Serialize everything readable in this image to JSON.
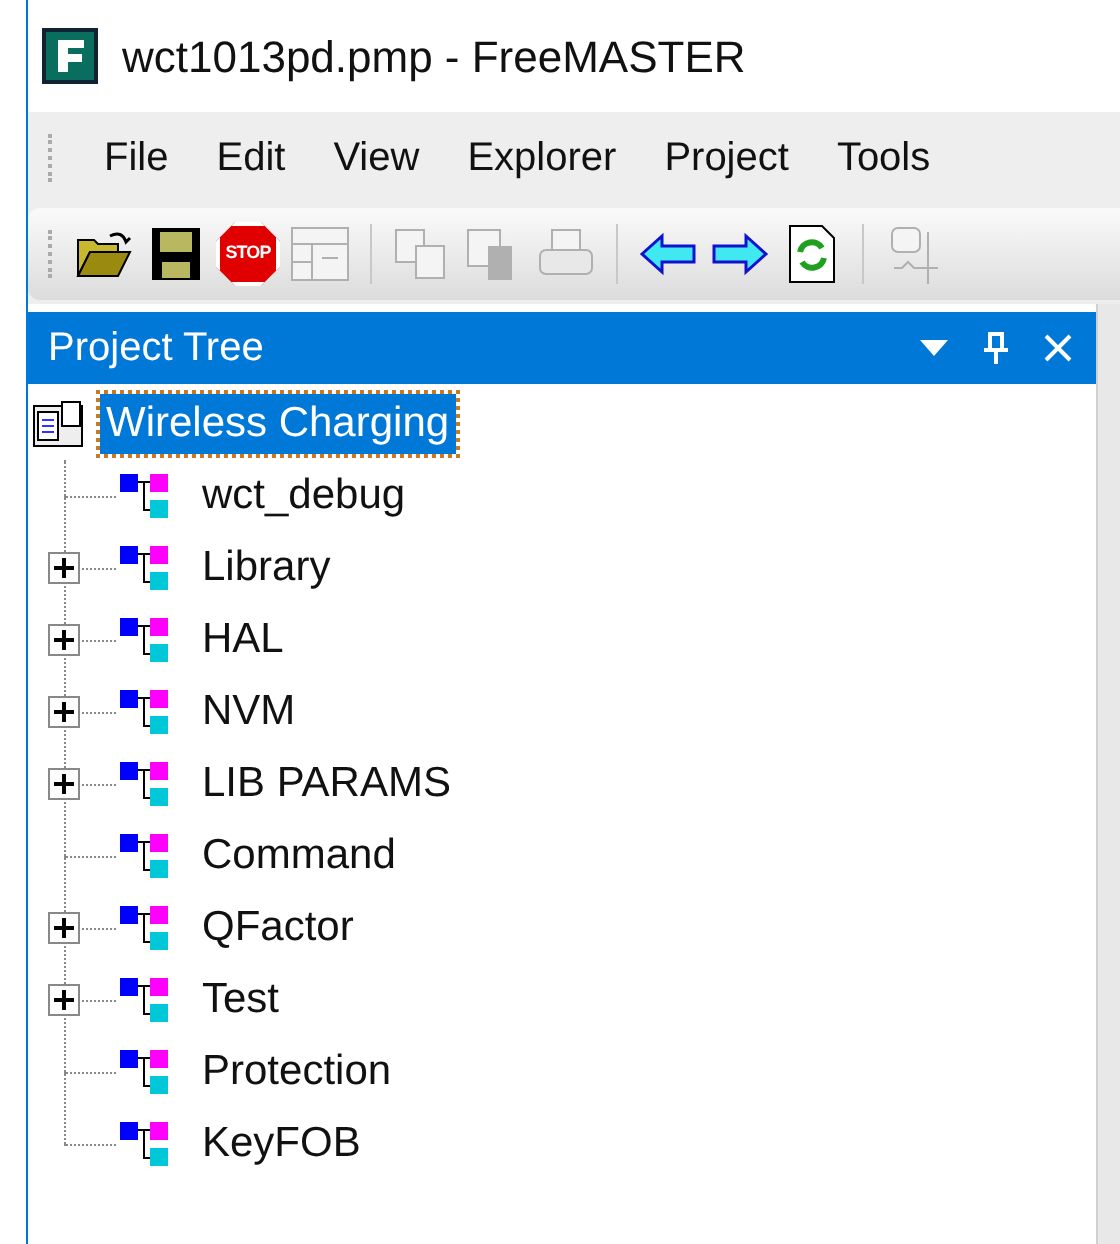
{
  "window": {
    "title": "wct1013pd.pmp - FreeMASTER"
  },
  "menu": [
    "File",
    "Edit",
    "View",
    "Explorer",
    "Project",
    "Tools"
  ],
  "toolbar": [
    {
      "kind": "open",
      "disabled": false
    },
    {
      "kind": "save",
      "disabled": false
    },
    {
      "kind": "stop",
      "disabled": false,
      "label": "STOP"
    },
    {
      "kind": "window",
      "disabled": true
    },
    {
      "kind": "separator"
    },
    {
      "kind": "copy",
      "disabled": true
    },
    {
      "kind": "paste",
      "disabled": true
    },
    {
      "kind": "print",
      "disabled": true
    },
    {
      "kind": "separator"
    },
    {
      "kind": "back",
      "disabled": false
    },
    {
      "kind": "forward",
      "disabled": false
    },
    {
      "kind": "refresh",
      "disabled": false
    },
    {
      "kind": "separator"
    },
    {
      "kind": "scope",
      "disabled": true
    }
  ],
  "panel": {
    "title": "Project Tree"
  },
  "tree": {
    "label": "Wireless Charging",
    "selected": true,
    "children": [
      {
        "label": "wct_debug",
        "has_children": false,
        "selected": false
      },
      {
        "label": "Library",
        "has_children": true,
        "selected": false
      },
      {
        "label": "HAL",
        "has_children": true,
        "selected": false
      },
      {
        "label": "NVM",
        "has_children": true,
        "selected": false
      },
      {
        "label": "LIB PARAMS",
        "has_children": true,
        "selected": false
      },
      {
        "label": "Command",
        "has_children": false,
        "selected": false
      },
      {
        "label": "QFactor",
        "has_children": true,
        "selected": false
      },
      {
        "label": "Test",
        "has_children": true,
        "selected": false
      },
      {
        "label": "Protection",
        "has_children": false,
        "selected": false
      },
      {
        "label": "KeyFOB",
        "has_children": false,
        "selected": false
      }
    ]
  }
}
